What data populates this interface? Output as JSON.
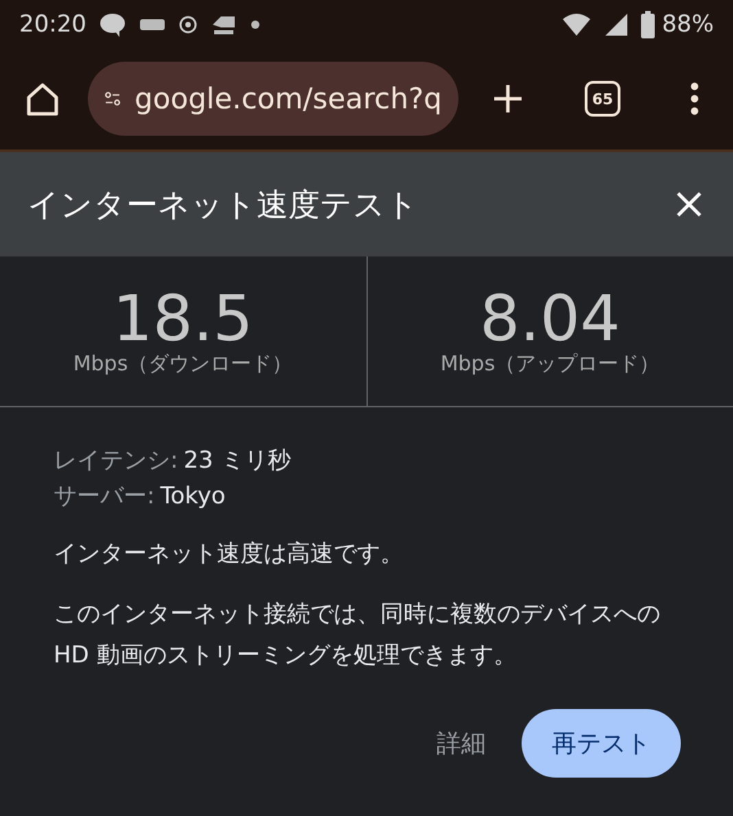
{
  "status_bar": {
    "time": "20:20",
    "battery": "88%"
  },
  "toolbar": {
    "url": "google.com/search?q",
    "tab_count": "65"
  },
  "dialog": {
    "title": "インターネット速度テスト",
    "results": [
      {
        "value": "18.5",
        "unit": "Mbps（ダウンロード）"
      },
      {
        "value": "8.04",
        "unit": "Mbps（アップロード）"
      }
    ],
    "details": [
      {
        "label": "レイテンシ:",
        "value": "23 ミリ秒"
      },
      {
        "label": "サーバー:",
        "value": "Tokyo"
      }
    ],
    "summary": "インターネット速度は高速です。",
    "description": "このインターネット接続では、同時に複数のデバイスへの HD 動画のストリーミングを処理できます。",
    "buttons": [
      {
        "label": "詳細",
        "kind": "text"
      },
      {
        "label": "再テスト",
        "kind": "filled"
      }
    ]
  }
}
